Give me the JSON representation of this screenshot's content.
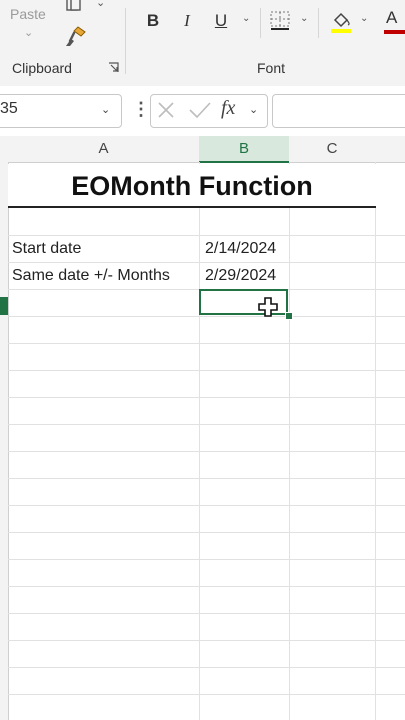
{
  "ribbon": {
    "paste_label": "Paste",
    "clipboard_group": "Clipboard",
    "font_group": "Font",
    "bold": "B",
    "italic": "I",
    "underline": "U",
    "font_color_glyph": "A"
  },
  "formula_bar": {
    "name_box": "35",
    "fx": "fx",
    "formula": ""
  },
  "columns": [
    "A",
    "B",
    "C"
  ],
  "sheet": {
    "title": "EOMonth Function",
    "rows": [
      {
        "label": "Start date",
        "value": "2/14/2024"
      },
      {
        "label": "Same date +/- Months",
        "value": "2/29/2024"
      }
    ]
  },
  "colors": {
    "accent_green": "#217346",
    "highlight_yellow": "#ffff00",
    "font_red": "#c00000"
  }
}
